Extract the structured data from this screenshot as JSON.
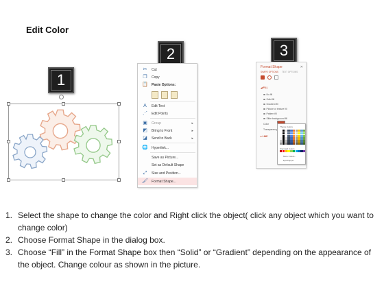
{
  "title": "Edit Color",
  "badges": [
    "1",
    "2",
    "3"
  ],
  "context_menu": {
    "items": [
      {
        "label": "Cut",
        "icon": "scissors-icon"
      },
      {
        "label": "Copy",
        "icon": "copy-icon"
      },
      {
        "label": "Paste Options:",
        "icon": "clipboard-icon"
      },
      {
        "label": "Edit Text",
        "icon": "edit-text-icon"
      },
      {
        "label": "Edit Points",
        "icon": "edit-points-icon"
      },
      {
        "label": "Group",
        "icon": "group-icon"
      },
      {
        "label": "Bring to Front",
        "icon": "bring-front-icon"
      },
      {
        "label": "Send to Back",
        "icon": "send-back-icon"
      },
      {
        "label": "Hyperlink...",
        "icon": "hyperlink-icon"
      },
      {
        "label": "Save as Picture...",
        "icon": ""
      },
      {
        "label": "Set as Default Shape",
        "icon": ""
      },
      {
        "label": "Size and Position...",
        "icon": "size-position-icon"
      },
      {
        "label": "Format Shape...",
        "icon": "format-shape-icon"
      }
    ]
  },
  "format_panel": {
    "title": "Format Shape",
    "tab_shape": "SHAPE OPTIONS",
    "tab_text": "TEXT OPTIONS",
    "fill_header": "FILL",
    "options": [
      "No fill",
      "Solid fill",
      "Gradient fill",
      "Picture or texture fill",
      "Pattern fill",
      "Slide background fill"
    ],
    "color_label": "Color",
    "transparency_label": "Transparency",
    "line_header": "LINE",
    "palette_title": "Theme Colors",
    "standard_label": "Standard Colors",
    "more_colors": "More Colors...",
    "eyedropper": "Eyedropper"
  },
  "instructions": [
    {
      "num": "1.",
      "text": "Select the shape to change the color and Right click the object( click any object which you want to change color)"
    },
    {
      "num": "2.",
      "text": "Choose Format Shape in the dialog box."
    },
    {
      "num": "3.",
      "text": "Choose “Fill” in the Format Shape box then “Solid” or “Gradient” depending on the appearance of the object. Change colour as shown in the picture."
    }
  ],
  "colors": {
    "gear_blue": "#8aa6c8",
    "gear_orange": "#e7a88c",
    "gear_green": "#95c98a",
    "accent_red": "#c44a2e",
    "highlight": "#fbe3e3"
  }
}
